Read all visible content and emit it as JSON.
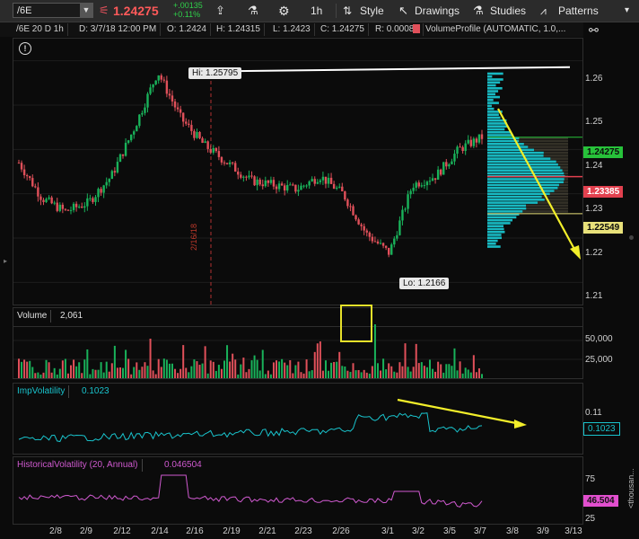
{
  "toolbar": {
    "symbol": "/6E",
    "price": "1.24275",
    "change": "+.00135",
    "change_pct": "+0.11%",
    "interval": "1h",
    "style_label": "Style",
    "drawings_label": "Drawings",
    "studies_label": "Studies",
    "patterns_label": "Patterns"
  },
  "header": {
    "title": "/6E 20 D 1h",
    "date": "D: 3/7/18 12:00 PM",
    "open": "O: 1.2424",
    "high": "H: 1.24315",
    "low": "L: 1.2423",
    "close": "C: 1.24275",
    "range": "R: 0.00085",
    "study": "VolumeProfile (AUTOMATIC, 1.0,..."
  },
  "price_pane": {
    "hi_label": "Hi: 1.25795",
    "lo_label": "Lo: 1.2166",
    "date_marker": "2/16/18",
    "ticks": [
      "1.26",
      "1.25",
      "1.24",
      "1.23",
      "1.22",
      "1.21"
    ],
    "last_tag": "1.24275",
    "poc_tag": "1.23385",
    "val_tag": "1.22549",
    "colors": {
      "up": "#19b25a",
      "down": "#e0505a",
      "profile": "#19c3cc",
      "tag_green": "#27c23a",
      "tag_red": "#e2414f",
      "tag_yellow": "#e8e17a"
    }
  },
  "volume_pane": {
    "label": "Volume",
    "value": "2,061",
    "ticks": [
      "50,000",
      "25,000"
    ],
    "unit": "<thousan..."
  },
  "impvol_pane": {
    "label": "ImpVolatility",
    "value": "0.1023",
    "ticks": [
      "0.11"
    ],
    "tag": "0.1023"
  },
  "histvol_pane": {
    "label": "HistoricalVolatility (20, Annual)",
    "value": "0.046504",
    "ticks": [
      "75",
      "50",
      "25"
    ],
    "tag": "46.504"
  },
  "dates": [
    "2/8",
    "2/9",
    "2/12",
    "2/14",
    "2/16",
    "2/19",
    "2/21",
    "2/23",
    "2/26",
    "3/1",
    "3/2",
    "3/5",
    "3/7",
    "3/8",
    "3/9",
    "3/13"
  ],
  "chart_data": {
    "type": "line",
    "series": [
      {
        "name": "/6E",
        "x": [
          "2/7",
          "2/8",
          "2/9",
          "2/12",
          "2/13",
          "2/14",
          "2/15",
          "2/16",
          "2/19",
          "2/20",
          "2/21",
          "2/22",
          "2/23",
          "2/26",
          "2/27",
          "2/28",
          "3/1",
          "3/2",
          "3/5",
          "3/6",
          "3/7"
        ],
        "values": [
          1.237,
          1.229,
          1.226,
          1.228,
          1.234,
          1.245,
          1.2575,
          1.247,
          1.241,
          1.237,
          1.233,
          1.232,
          1.231,
          1.234,
          1.23,
          1.221,
          1.2166,
          1.232,
          1.234,
          1.24,
          1.24275
        ]
      }
    ],
    "ylim": [
      1.205,
      1.265
    ]
  }
}
